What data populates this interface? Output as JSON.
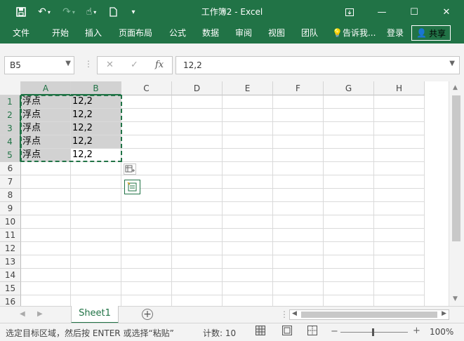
{
  "title_bar": {
    "window_title": "工作簿2 - Excel",
    "quick_access_icons": [
      "save-icon",
      "undo-icon",
      "redo-icon",
      "touch-mode-icon",
      "new-document-icon",
      "customize-icon"
    ],
    "window_controls": [
      "ribbon-display-icon",
      "minimize-icon",
      "maximize-icon",
      "close-icon"
    ]
  },
  "ribbon": {
    "tabs": [
      "文件",
      "开始",
      "插入",
      "页面布局",
      "公式",
      "数据",
      "审阅",
      "视图",
      "团队"
    ],
    "tell_me": "告诉我...",
    "login": "登录",
    "share": "共享"
  },
  "formula_bar": {
    "name_box": "B5",
    "fx": "fx",
    "value": "12,2"
  },
  "grid": {
    "columns": [
      "A",
      "B",
      "C",
      "D",
      "E",
      "F",
      "G",
      "H"
    ],
    "rows": [
      "1",
      "2",
      "3",
      "4",
      "5",
      "6",
      "7",
      "8",
      "9",
      "10",
      "11",
      "12",
      "13",
      "14",
      "15",
      "16"
    ],
    "cells": [
      [
        "浮点",
        "12,2"
      ],
      [
        "浮点",
        "12,2"
      ],
      [
        "浮点",
        "12,2"
      ],
      [
        "浮点",
        "12,2"
      ],
      [
        "浮点",
        "12,2"
      ]
    ]
  },
  "sheet_tabs": {
    "active": "Sheet1"
  },
  "status_bar": {
    "message": "选定目标区域，然后按 ENTER 或选择“粘贴”",
    "count": "计数: 10",
    "zoom": "100%",
    "view_icons": [
      "normal-view-icon",
      "page-layout-view-icon",
      "page-break-view-icon"
    ]
  },
  "colors": {
    "excel_green": "#217346",
    "selection_gray": "#d2d2d2",
    "chrome_gray": "#f3f3f3"
  }
}
